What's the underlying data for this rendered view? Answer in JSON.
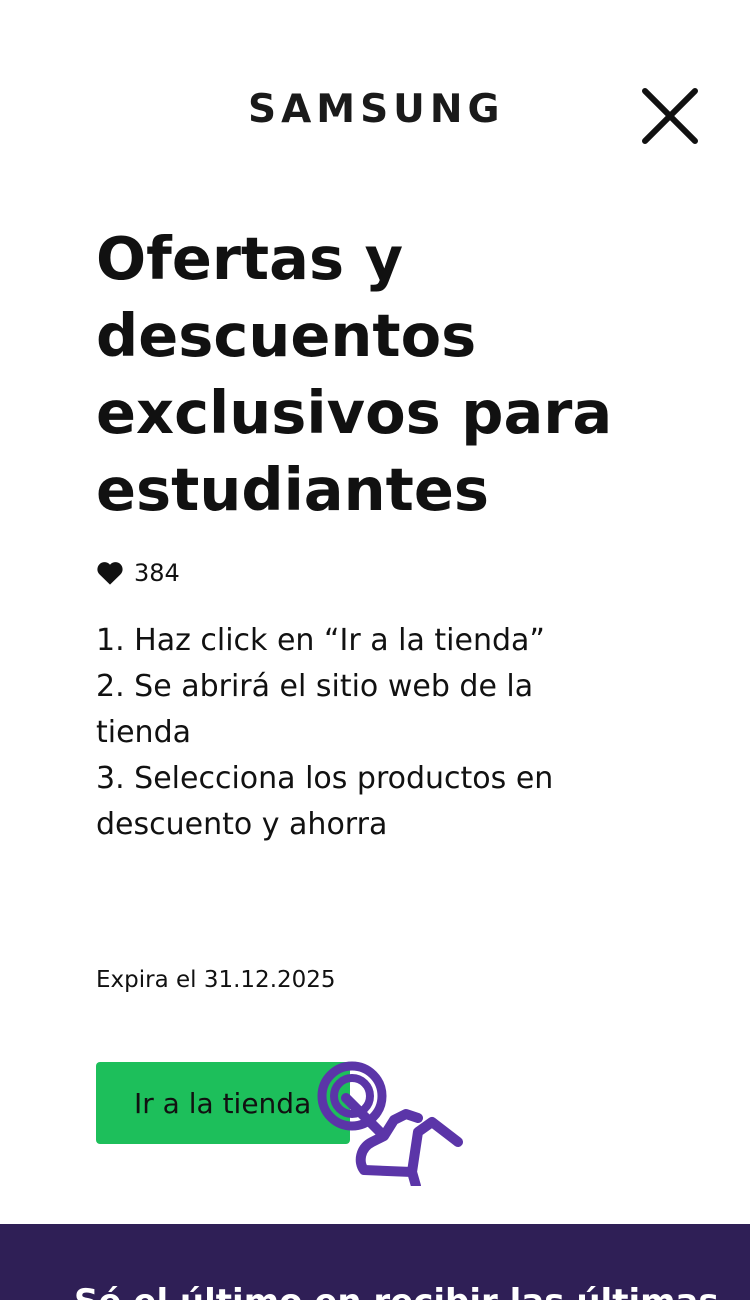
{
  "header": {
    "logo_text": "SAMSUNG",
    "close_icon": "close-icon"
  },
  "offer": {
    "title": "Ofertas y descuentos exclusivos para estudiantes",
    "likes_icon": "heart-icon",
    "likes_count": "384",
    "steps": [
      "1. Haz click en “Ir a la tienda”",
      "2. Se abrirá el sitio web de la tienda",
      "3. Selecciona los productos en descuento y ahorra"
    ],
    "expiry": "Expira el 31.12.2025",
    "cta_label": "Ir a la tienda",
    "cta_color": "#1dbf5b",
    "pointer_icon": "hand-pointer-icon",
    "pointer_color": "#5b35a8"
  },
  "footer": {
    "partial_text": "Sé el último en recibir las últimas",
    "band_color": "#2f1f56"
  }
}
